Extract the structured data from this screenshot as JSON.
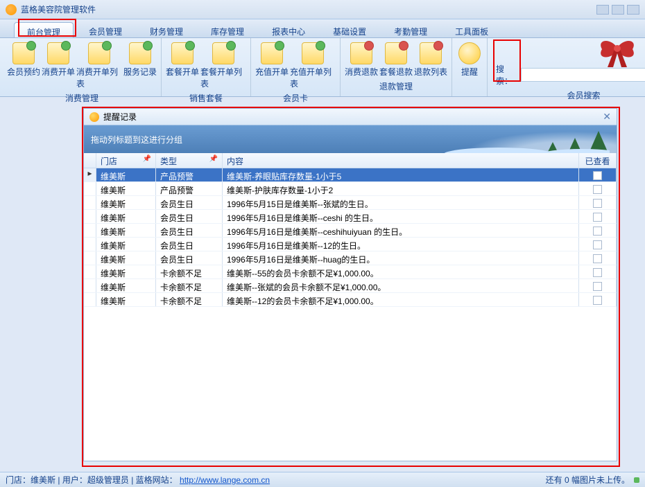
{
  "app": {
    "title": "蓝格美容院管理软件"
  },
  "tabs": [
    "前台管理",
    "会员管理",
    "财务管理",
    "库存管理",
    "报表中心",
    "基础设置",
    "考勤管理",
    "工具面板"
  ],
  "active_tab": 0,
  "ribbon": {
    "groups": [
      {
        "label": "消费管理",
        "items": [
          "会员预约",
          "消费开单",
          "消费开单列表",
          "服务记录"
        ]
      },
      {
        "label": "销售套餐",
        "items": [
          "套餐开单",
          "套餐开单列表"
        ]
      },
      {
        "label": "会员卡",
        "items": [
          "充值开单",
          "充值开单列表"
        ]
      },
      {
        "label": "退款管理",
        "items": [
          "消费退款",
          "套餐退款",
          "退款列表"
        ]
      },
      {
        "label_only": "提醒"
      }
    ],
    "search_label": "搜索：",
    "search_group_label": "会员搜索"
  },
  "reminder_window": {
    "title": "提醒记录",
    "group_hint": "拖动列标题到这进行分组",
    "columns": [
      "门店",
      "类型",
      "内容",
      "已查看"
    ],
    "rows": [
      {
        "store": "维美斯",
        "type": "产品预警",
        "content": "维美斯-养眼贴库存数量-1小于5",
        "viewed": false,
        "selected": true
      },
      {
        "store": "维美斯",
        "type": "产品预警",
        "content": "维美斯-护肤库存数量-1小于2",
        "viewed": false
      },
      {
        "store": "维美斯",
        "type": "会员生日",
        "content": "1996年5月15日是维美斯--张斌的生日。",
        "viewed": false
      },
      {
        "store": "维美斯",
        "type": "会员生日",
        "content": "1996年5月16日是维美斯--ceshi 的生日。",
        "viewed": false
      },
      {
        "store": "维美斯",
        "type": "会员生日",
        "content": "1996年5月16日是维美斯--ceshihuiyuan 的生日。",
        "viewed": false
      },
      {
        "store": "维美斯",
        "type": "会员生日",
        "content": "1996年5月16日是维美斯--12的生日。",
        "viewed": false
      },
      {
        "store": "维美斯",
        "type": "会员生日",
        "content": "1996年5月16日是维美斯--huag的生日。",
        "viewed": false
      },
      {
        "store": "维美斯",
        "type": "卡余额不足",
        "content": "维美斯--55的会员卡余额不足¥1,000.00。",
        "viewed": false
      },
      {
        "store": "维美斯",
        "type": "卡余额不足",
        "content": "维美斯--张斌的会员卡余额不足¥1,000.00。",
        "viewed": false
      },
      {
        "store": "维美斯",
        "type": "卡余额不足",
        "content": "维美斯--12的会员卡余额不足¥1,000.00。",
        "viewed": false
      }
    ]
  },
  "status": {
    "store_label": "门店：",
    "store": "维美斯",
    "user_label": "用户：",
    "user": "超级管理员",
    "site_label": "蓝格网站：",
    "site_url": "http://www.lange.com.cn",
    "right_text": "还有 0 幅图片未上传。"
  }
}
